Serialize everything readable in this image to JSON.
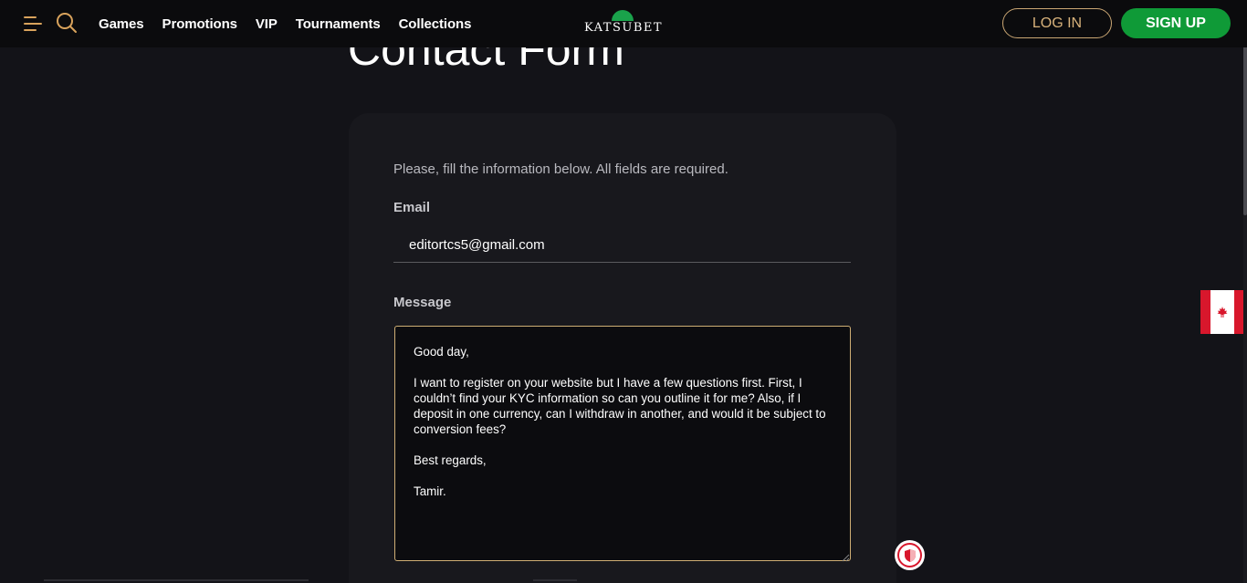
{
  "header": {
    "nav": [
      "Games",
      "Promotions",
      "VIP",
      "Tournaments",
      "Collections"
    ],
    "logo_text": "KATSUBET",
    "login_label": "LOG IN",
    "signup_label": "SIGN UP"
  },
  "page_title": "Contact Form",
  "form": {
    "intro": "Please, fill the information below. All fields are required.",
    "email_label": "Email",
    "email_value": "editortcs5@gmail.com",
    "message_label": "Message",
    "message_value": "Good day,\n\nI want to register on your website but I have a few questions first. First, I couldn’t find your KYC information so can you outline it for me? Also, if I deposit in one currency, can I withdraw in another, and would it be subject to conversion fees?\n\nBest regards,\n\nTamir."
  },
  "icons": {
    "menu": "menu-icon",
    "search": "search-icon",
    "flag": "canada-flag-icon",
    "shield": "shield-icon"
  },
  "colors": {
    "background": "#131318",
    "header": "#0b0b0d",
    "accent_gold": "#d9a35c",
    "signup_green": "#0f9a37",
    "flag_red": "#d8172c"
  }
}
